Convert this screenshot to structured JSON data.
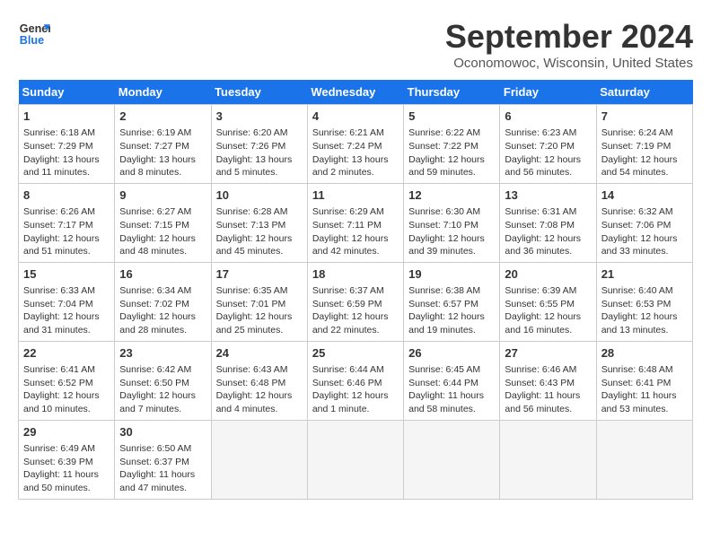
{
  "header": {
    "logo_line1": "General",
    "logo_line2": "Blue",
    "month": "September 2024",
    "location": "Oconomowoc, Wisconsin, United States"
  },
  "weekdays": [
    "Sunday",
    "Monday",
    "Tuesday",
    "Wednesday",
    "Thursday",
    "Friday",
    "Saturday"
  ],
  "weeks": [
    [
      {
        "day": 1,
        "rise": "6:18 AM",
        "set": "7:29 PM",
        "hours": "13 hours and 11 minutes."
      },
      {
        "day": 2,
        "rise": "6:19 AM",
        "set": "7:27 PM",
        "hours": "13 hours and 8 minutes."
      },
      {
        "day": 3,
        "rise": "6:20 AM",
        "set": "7:26 PM",
        "hours": "13 hours and 5 minutes."
      },
      {
        "day": 4,
        "rise": "6:21 AM",
        "set": "7:24 PM",
        "hours": "13 hours and 2 minutes."
      },
      {
        "day": 5,
        "rise": "6:22 AM",
        "set": "7:22 PM",
        "hours": "12 hours and 59 minutes."
      },
      {
        "day": 6,
        "rise": "6:23 AM",
        "set": "7:20 PM",
        "hours": "12 hours and 56 minutes."
      },
      {
        "day": 7,
        "rise": "6:24 AM",
        "set": "7:19 PM",
        "hours": "12 hours and 54 minutes."
      }
    ],
    [
      {
        "day": 8,
        "rise": "6:26 AM",
        "set": "7:17 PM",
        "hours": "12 hours and 51 minutes."
      },
      {
        "day": 9,
        "rise": "6:27 AM",
        "set": "7:15 PM",
        "hours": "12 hours and 48 minutes."
      },
      {
        "day": 10,
        "rise": "6:28 AM",
        "set": "7:13 PM",
        "hours": "12 hours and 45 minutes."
      },
      {
        "day": 11,
        "rise": "6:29 AM",
        "set": "7:11 PM",
        "hours": "12 hours and 42 minutes."
      },
      {
        "day": 12,
        "rise": "6:30 AM",
        "set": "7:10 PM",
        "hours": "12 hours and 39 minutes."
      },
      {
        "day": 13,
        "rise": "6:31 AM",
        "set": "7:08 PM",
        "hours": "12 hours and 36 minutes."
      },
      {
        "day": 14,
        "rise": "6:32 AM",
        "set": "7:06 PM",
        "hours": "12 hours and 33 minutes."
      }
    ],
    [
      {
        "day": 15,
        "rise": "6:33 AM",
        "set": "7:04 PM",
        "hours": "12 hours and 31 minutes."
      },
      {
        "day": 16,
        "rise": "6:34 AM",
        "set": "7:02 PM",
        "hours": "12 hours and 28 minutes."
      },
      {
        "day": 17,
        "rise": "6:35 AM",
        "set": "7:01 PM",
        "hours": "12 hours and 25 minutes."
      },
      {
        "day": 18,
        "rise": "6:37 AM",
        "set": "6:59 PM",
        "hours": "12 hours and 22 minutes."
      },
      {
        "day": 19,
        "rise": "6:38 AM",
        "set": "6:57 PM",
        "hours": "12 hours and 19 minutes."
      },
      {
        "day": 20,
        "rise": "6:39 AM",
        "set": "6:55 PM",
        "hours": "12 hours and 16 minutes."
      },
      {
        "day": 21,
        "rise": "6:40 AM",
        "set": "6:53 PM",
        "hours": "12 hours and 13 minutes."
      }
    ],
    [
      {
        "day": 22,
        "rise": "6:41 AM",
        "set": "6:52 PM",
        "hours": "12 hours and 10 minutes."
      },
      {
        "day": 23,
        "rise": "6:42 AM",
        "set": "6:50 PM",
        "hours": "12 hours and 7 minutes."
      },
      {
        "day": 24,
        "rise": "6:43 AM",
        "set": "6:48 PM",
        "hours": "12 hours and 4 minutes."
      },
      {
        "day": 25,
        "rise": "6:44 AM",
        "set": "6:46 PM",
        "hours": "12 hours and 1 minute."
      },
      {
        "day": 26,
        "rise": "6:45 AM",
        "set": "6:44 PM",
        "hours": "11 hours and 58 minutes."
      },
      {
        "day": 27,
        "rise": "6:46 AM",
        "set": "6:43 PM",
        "hours": "11 hours and 56 minutes."
      },
      {
        "day": 28,
        "rise": "6:48 AM",
        "set": "6:41 PM",
        "hours": "11 hours and 53 minutes."
      }
    ],
    [
      {
        "day": 29,
        "rise": "6:49 AM",
        "set": "6:39 PM",
        "hours": "11 hours and 50 minutes."
      },
      {
        "day": 30,
        "rise": "6:50 AM",
        "set": "6:37 PM",
        "hours": "11 hours and 47 minutes."
      },
      null,
      null,
      null,
      null,
      null
    ]
  ]
}
